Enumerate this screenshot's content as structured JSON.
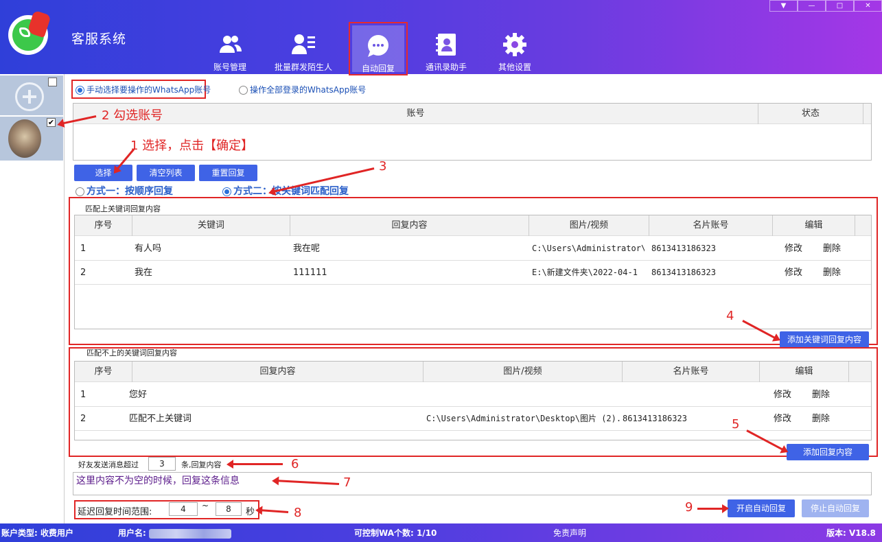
{
  "app": {
    "title": "客服系统"
  },
  "window_controls": [
    "▼",
    "—",
    "□",
    "✕"
  ],
  "nav": [
    {
      "label": "账号管理",
      "icon": "users-icon"
    },
    {
      "label": "批量群发陌生人",
      "icon": "user-list-icon"
    },
    {
      "label": "自动回复",
      "icon": "chat-bubble-icon",
      "active": true
    },
    {
      "label": "通讯录助手",
      "icon": "contacts-book-icon"
    },
    {
      "label": "其他设置",
      "icon": "gear-icon"
    }
  ],
  "account_mode": {
    "option1": "手动选择要操作的WhatsApp账号",
    "option2": "操作全部登录的WhatsApp账号",
    "selected": 1
  },
  "account_table": {
    "col_account": "账号",
    "col_status": "状态"
  },
  "buttons": {
    "select": "选择",
    "clear_list": "清空列表",
    "reset_reply": "重置回复",
    "add_keyword_reply": "添加关键词回复内容",
    "add_reply": "添加回复内容",
    "start_auto_reply": "开启自动回复",
    "stop_auto_reply": "停止自动回复"
  },
  "reply_mode": {
    "option1": "方式一：按顺序回复",
    "option2": "方式二：按关键词匹配回复",
    "selected": 2
  },
  "keyword_section": {
    "title": "匹配上关键词回复内容",
    "columns": [
      "序号",
      "关键词",
      "回复内容",
      "图片/视频",
      "名片账号",
      "编辑"
    ],
    "rows": [
      {
        "no": "1",
        "keyword": "有人吗",
        "reply": "我在呢",
        "media": "C:\\Users\\Administrator\\",
        "card": "8613413186323",
        "edit": "修改",
        "delete": "删除"
      },
      {
        "no": "2",
        "keyword": "我在",
        "reply": "111111",
        "media": "E:\\新建文件夹\\2022-04-1",
        "card": "8613413186323",
        "edit": "修改",
        "delete": "删除"
      }
    ]
  },
  "nomatch_section": {
    "title": "匹配不上的关键词回复内容",
    "columns": [
      "序号",
      "回复内容",
      "图片/视频",
      "名片账号",
      "编辑"
    ],
    "rows": [
      {
        "no": "1",
        "reply": "您好",
        "media": "",
        "card": "",
        "edit": "修改",
        "delete": "删除"
      },
      {
        "no": "2",
        "reply": "匹配不上关键词",
        "media": "C:\\Users\\Administrator\\Desktop\\图片 (2).",
        "card": "8613413186323",
        "edit": "修改",
        "delete": "删除"
      }
    ]
  },
  "friend_msg": {
    "prefix": "好友发送消息超过",
    "value": "3",
    "suffix": "条,回复内容"
  },
  "reply_text": "这里内容不为空的时候，回复这条信息",
  "delay": {
    "label": "延迟回复时间范围:",
    "min": "4",
    "sep": "~",
    "max": "8",
    "unit": "秒"
  },
  "annotations": {
    "a1": "1 选择，点击【确定】",
    "a2": "2 勾选账号",
    "a3": "3",
    "a4": "4",
    "a5": "5",
    "a6": "6",
    "a7": "7",
    "a8": "8",
    "a9": "9"
  },
  "statusbar": {
    "account_type": "账户类型: 收费用户",
    "username_label": "用户名:",
    "wa_count": "可控制WA个数: 1/10",
    "disclaimer": "免责声明",
    "version": "版本: V18.8"
  },
  "colors": {
    "accent": "#3f63e6",
    "annotation_red": "#e02525",
    "header_start": "#2f3fd9",
    "header_end": "#a437e6"
  }
}
